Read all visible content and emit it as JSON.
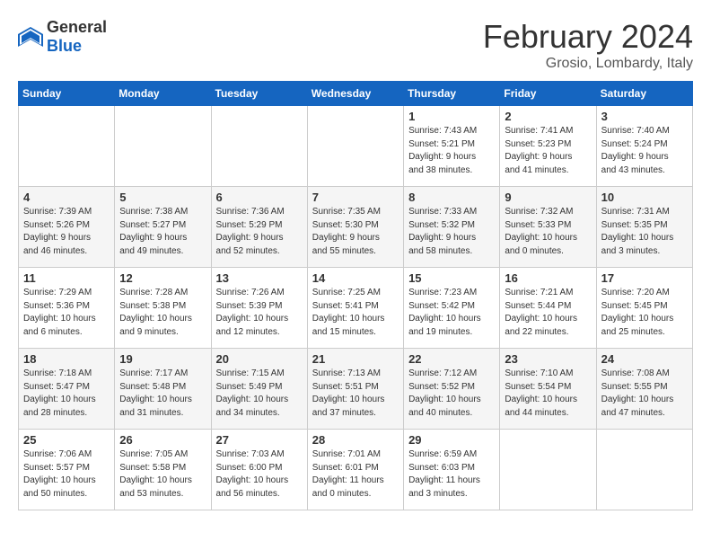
{
  "header": {
    "logo_general": "General",
    "logo_blue": "Blue",
    "month_year": "February 2024",
    "location": "Grosio, Lombardy, Italy"
  },
  "weekdays": [
    "Sunday",
    "Monday",
    "Tuesday",
    "Wednesday",
    "Thursday",
    "Friday",
    "Saturday"
  ],
  "weeks": [
    [
      {
        "day": "",
        "info": ""
      },
      {
        "day": "",
        "info": ""
      },
      {
        "day": "",
        "info": ""
      },
      {
        "day": "",
        "info": ""
      },
      {
        "day": "1",
        "info": "Sunrise: 7:43 AM\nSunset: 5:21 PM\nDaylight: 9 hours\nand 38 minutes."
      },
      {
        "day": "2",
        "info": "Sunrise: 7:41 AM\nSunset: 5:23 PM\nDaylight: 9 hours\nand 41 minutes."
      },
      {
        "day": "3",
        "info": "Sunrise: 7:40 AM\nSunset: 5:24 PM\nDaylight: 9 hours\nand 43 minutes."
      }
    ],
    [
      {
        "day": "4",
        "info": "Sunrise: 7:39 AM\nSunset: 5:26 PM\nDaylight: 9 hours\nand 46 minutes."
      },
      {
        "day": "5",
        "info": "Sunrise: 7:38 AM\nSunset: 5:27 PM\nDaylight: 9 hours\nand 49 minutes."
      },
      {
        "day": "6",
        "info": "Sunrise: 7:36 AM\nSunset: 5:29 PM\nDaylight: 9 hours\nand 52 minutes."
      },
      {
        "day": "7",
        "info": "Sunrise: 7:35 AM\nSunset: 5:30 PM\nDaylight: 9 hours\nand 55 minutes."
      },
      {
        "day": "8",
        "info": "Sunrise: 7:33 AM\nSunset: 5:32 PM\nDaylight: 9 hours\nand 58 minutes."
      },
      {
        "day": "9",
        "info": "Sunrise: 7:32 AM\nSunset: 5:33 PM\nDaylight: 10 hours\nand 0 minutes."
      },
      {
        "day": "10",
        "info": "Sunrise: 7:31 AM\nSunset: 5:35 PM\nDaylight: 10 hours\nand 3 minutes."
      }
    ],
    [
      {
        "day": "11",
        "info": "Sunrise: 7:29 AM\nSunset: 5:36 PM\nDaylight: 10 hours\nand 6 minutes."
      },
      {
        "day": "12",
        "info": "Sunrise: 7:28 AM\nSunset: 5:38 PM\nDaylight: 10 hours\nand 9 minutes."
      },
      {
        "day": "13",
        "info": "Sunrise: 7:26 AM\nSunset: 5:39 PM\nDaylight: 10 hours\nand 12 minutes."
      },
      {
        "day": "14",
        "info": "Sunrise: 7:25 AM\nSunset: 5:41 PM\nDaylight: 10 hours\nand 15 minutes."
      },
      {
        "day": "15",
        "info": "Sunrise: 7:23 AM\nSunset: 5:42 PM\nDaylight: 10 hours\nand 19 minutes."
      },
      {
        "day": "16",
        "info": "Sunrise: 7:21 AM\nSunset: 5:44 PM\nDaylight: 10 hours\nand 22 minutes."
      },
      {
        "day": "17",
        "info": "Sunrise: 7:20 AM\nSunset: 5:45 PM\nDaylight: 10 hours\nand 25 minutes."
      }
    ],
    [
      {
        "day": "18",
        "info": "Sunrise: 7:18 AM\nSunset: 5:47 PM\nDaylight: 10 hours\nand 28 minutes."
      },
      {
        "day": "19",
        "info": "Sunrise: 7:17 AM\nSunset: 5:48 PM\nDaylight: 10 hours\nand 31 minutes."
      },
      {
        "day": "20",
        "info": "Sunrise: 7:15 AM\nSunset: 5:49 PM\nDaylight: 10 hours\nand 34 minutes."
      },
      {
        "day": "21",
        "info": "Sunrise: 7:13 AM\nSunset: 5:51 PM\nDaylight: 10 hours\nand 37 minutes."
      },
      {
        "day": "22",
        "info": "Sunrise: 7:12 AM\nSunset: 5:52 PM\nDaylight: 10 hours\nand 40 minutes."
      },
      {
        "day": "23",
        "info": "Sunrise: 7:10 AM\nSunset: 5:54 PM\nDaylight: 10 hours\nand 44 minutes."
      },
      {
        "day": "24",
        "info": "Sunrise: 7:08 AM\nSunset: 5:55 PM\nDaylight: 10 hours\nand 47 minutes."
      }
    ],
    [
      {
        "day": "25",
        "info": "Sunrise: 7:06 AM\nSunset: 5:57 PM\nDaylight: 10 hours\nand 50 minutes."
      },
      {
        "day": "26",
        "info": "Sunrise: 7:05 AM\nSunset: 5:58 PM\nDaylight: 10 hours\nand 53 minutes."
      },
      {
        "day": "27",
        "info": "Sunrise: 7:03 AM\nSunset: 6:00 PM\nDaylight: 10 hours\nand 56 minutes."
      },
      {
        "day": "28",
        "info": "Sunrise: 7:01 AM\nSunset: 6:01 PM\nDaylight: 11 hours\nand 0 minutes."
      },
      {
        "day": "29",
        "info": "Sunrise: 6:59 AM\nSunset: 6:03 PM\nDaylight: 11 hours\nand 3 minutes."
      },
      {
        "day": "",
        "info": ""
      },
      {
        "day": "",
        "info": ""
      }
    ]
  ]
}
